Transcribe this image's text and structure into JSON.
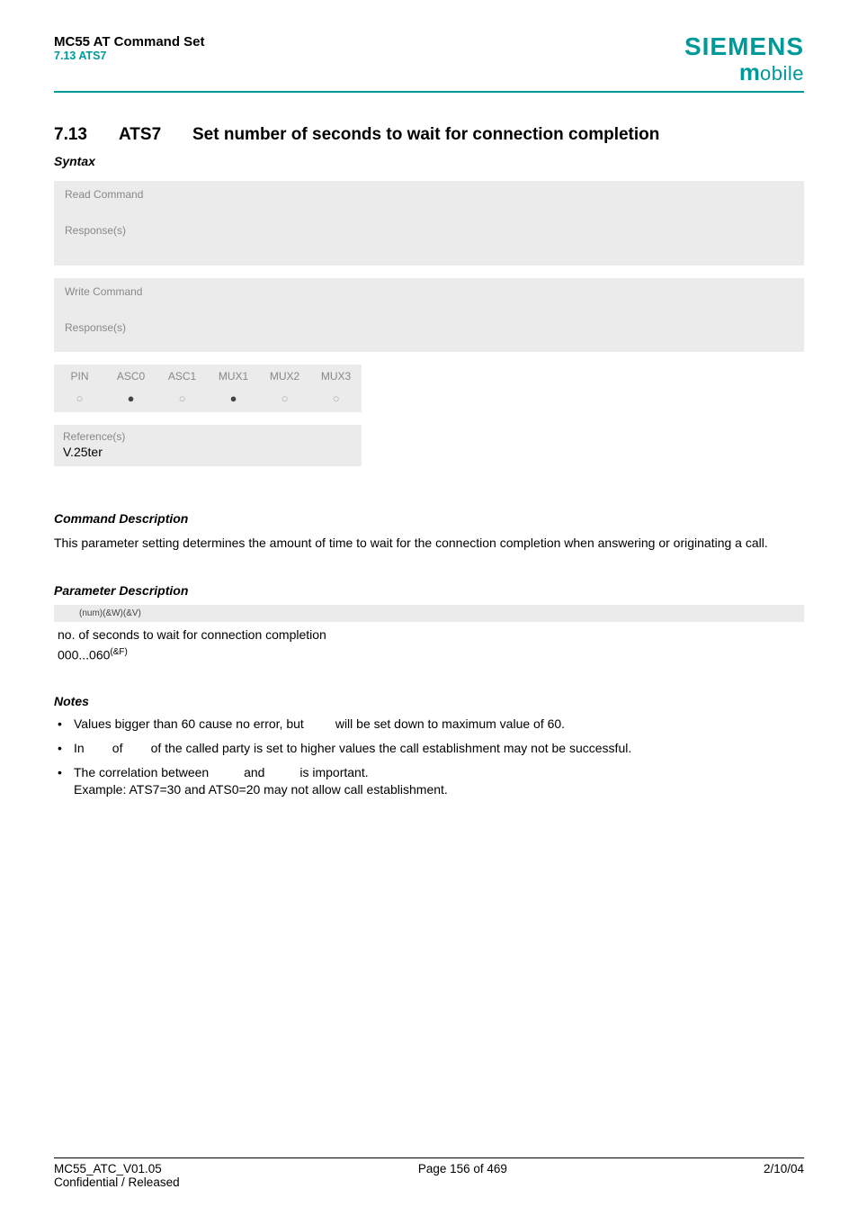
{
  "header": {
    "doc_title": "MC55 AT Command Set",
    "sub_title": "7.13 ATS7",
    "brand": "SIEMENS",
    "brand_sub_m": "m",
    "brand_sub_obile": "obile"
  },
  "section": {
    "number": "7.13",
    "cmd": "ATS7",
    "title": "Set number of seconds to wait for connection completion"
  },
  "syntax_label": "Syntax",
  "panels": {
    "read_label": "Read Command",
    "read_response": "Response(s)",
    "write_label": "Write Command",
    "write_response": "Response(s)"
  },
  "grid": {
    "headers": [
      "PIN",
      "ASC0",
      "ASC1",
      "MUX1",
      "MUX2",
      "MUX3"
    ],
    "cells": [
      "○",
      "●",
      "○",
      "●",
      "○",
      "○"
    ]
  },
  "reference": {
    "label": "Reference(s)",
    "value": "V.25ter"
  },
  "cmd_desc": {
    "heading": "Command Description",
    "body": "This parameter setting determines the amount of time to wait for the connection completion when answering or originating a call."
  },
  "param": {
    "heading": "Parameter Description",
    "bar": "(num)(&W)(&V)",
    "line": "no. of seconds to wait for connection completion",
    "range_pre": "000...060",
    "range_sup": "(&F)"
  },
  "notes": {
    "heading": "Notes",
    "items": [
      {
        "a": "Values bigger than 60 cause no error, but ",
        "b": " will be set down to maximum value of 60."
      },
      {
        "a": "In ",
        "b": " of ",
        "c": " of the called party is set to higher values the call establishment may not be successful."
      },
      {
        "a": "The correlation between ",
        "b": " and ",
        "c": " is important.",
        "d": "Example: ATS7=30 and ATS0=20 may not allow call establishment."
      }
    ]
  },
  "footer": {
    "left1": "MC55_ATC_V01.05",
    "center": "Page 156 of 469",
    "right": "2/10/04",
    "left2": "Confidential / Released"
  }
}
